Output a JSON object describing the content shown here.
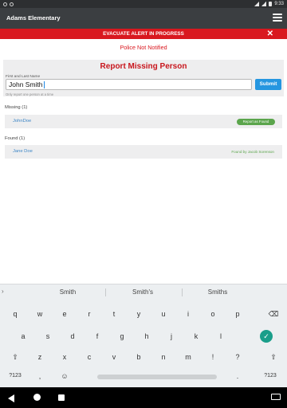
{
  "status_bar": {
    "time": "9:33"
  },
  "app_bar": {
    "title": "Adams Elementary"
  },
  "alert": {
    "text": "EVACUATE ALERT IN PROGRESS",
    "close": "✕"
  },
  "police_status": "Police Not Notified",
  "report": {
    "heading": "Report Missing Person",
    "field_label": "First and Last Name",
    "field_value": "John Smith",
    "submit_label": "Submit",
    "hint": "Only report one person at a time"
  },
  "missing": {
    "label": "Missing (1)",
    "items": [
      {
        "name": "JohnDoe",
        "action": "Report as Found"
      }
    ]
  },
  "found": {
    "label": "Found (1)",
    "items": [
      {
        "name": "Jane Doe",
        "found_by": "Found by Jacob Sorenson"
      }
    ]
  },
  "keyboard": {
    "suggestions": [
      "Smith",
      "Smith's",
      "Smiths"
    ],
    "row1": [
      "q",
      "w",
      "e",
      "r",
      "t",
      "y",
      "u",
      "i",
      "o",
      "p"
    ],
    "row2": [
      "a",
      "s",
      "d",
      "f",
      "g",
      "h",
      "j",
      "k",
      "l"
    ],
    "row3": [
      "z",
      "x",
      "c",
      "v",
      "b",
      "n",
      "m",
      "!",
      "?"
    ],
    "row4_left": "?123",
    "row4_comma": ",",
    "row4_period": ".",
    "row4_right": "?123"
  },
  "colors": {
    "alert_red": "#d9181f",
    "submit_blue": "#2596e0",
    "found_green": "#5ba54c",
    "link_blue": "#3d86c6"
  }
}
